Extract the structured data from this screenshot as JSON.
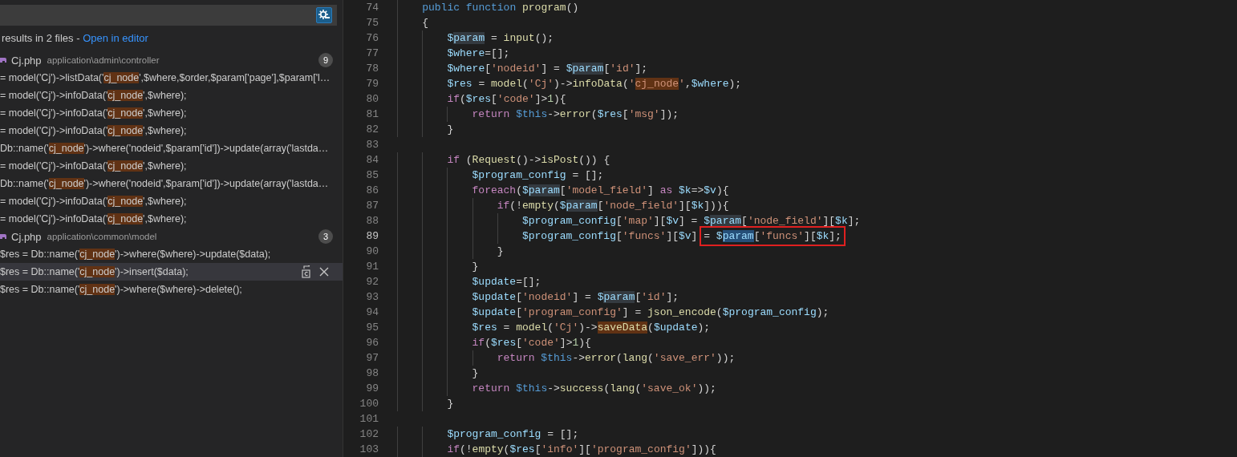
{
  "search_panel": {
    "exclude_settings_toggle": {
      "on": true
    },
    "summary": {
      "text": "results in 2 files - ",
      "link": "Open in editor"
    },
    "files": [
      {
        "name": "Cj.php",
        "path": "application\\admin\\controller",
        "count": "9",
        "matches": [
          {
            "before": "= model('Cj')->listData('",
            "match": "cj_node",
            "after": "',$where,$order,$param['page'],$param['l…",
            "selected": false
          },
          {
            "before": "= model('Cj')->infoData('",
            "match": "cj_node",
            "after": "',$where);",
            "selected": false
          },
          {
            "before": "= model('Cj')->infoData('",
            "match": "cj_node",
            "after": "',$where);",
            "selected": false
          },
          {
            "before": "= model('Cj')->infoData('",
            "match": "cj_node",
            "after": "',$where);",
            "selected": false
          },
          {
            "before": "Db::name('",
            "match": "cj_node",
            "after": "')->where('nodeid',$param['id'])->update(array('lastda…",
            "selected": false
          },
          {
            "before": "= model('Cj')->infoData('",
            "match": "cj_node",
            "after": "',$where);",
            "selected": false
          },
          {
            "before": "Db::name('",
            "match": "cj_node",
            "after": "')->where('nodeid',$param['id'])->update(array('lastda…",
            "selected": false
          },
          {
            "before": "= model('Cj')->infoData('",
            "match": "cj_node",
            "after": "',$where);",
            "selected": false
          },
          {
            "before": "= model('Cj')->infoData('",
            "match": "cj_node",
            "after": "',$where);",
            "selected": false
          }
        ]
      },
      {
        "name": "Cj.php",
        "path": "application\\common\\model",
        "count": "3",
        "matches": [
          {
            "before": "$res = Db::name('",
            "match": "cj_node",
            "after": "')->where($where)->update($data);",
            "selected": false
          },
          {
            "before": "$res = Db::name('",
            "match": "cj_node",
            "after": "')->insert($data);",
            "selected": true
          },
          {
            "before": "$res = Db::name('",
            "match": "cj_node",
            "after": "')->where($where)->delete();",
            "selected": false
          }
        ]
      }
    ]
  },
  "editor": {
    "lines": [
      {
        "number": "74",
        "current": false,
        "tokens": [
          {
            "text": "    public",
            "kind": "keyword"
          },
          {
            "text": " function",
            "kind": "keyword"
          },
          {
            "text": " program",
            "kind": "function"
          },
          {
            "text": "()",
            "kind": "plain"
          }
        ]
      },
      {
        "number": "75",
        "current": false,
        "tokens": [
          {
            "text": "    {",
            "kind": "plain"
          }
        ]
      },
      {
        "number": "76",
        "current": false,
        "tokens": [
          {
            "text": "        $",
            "kind": "variable"
          },
          {
            "text": "param",
            "kind": "variable",
            "same_word": true
          },
          {
            "text": " = ",
            "kind": "plain"
          },
          {
            "text": "input",
            "kind": "function"
          },
          {
            "text": "();",
            "kind": "plain"
          }
        ]
      },
      {
        "number": "77",
        "current": false,
        "tokens": [
          {
            "text": "        $where",
            "kind": "variable"
          },
          {
            "text": "=[];",
            "kind": "plain"
          }
        ]
      },
      {
        "number": "78",
        "current": false,
        "tokens": [
          {
            "text": "        $where",
            "kind": "variable"
          },
          {
            "text": "[",
            "kind": "plain"
          },
          {
            "text": "'nodeid'",
            "kind": "string"
          },
          {
            "text": "] = ",
            "kind": "plain"
          },
          {
            "text": "$",
            "kind": "variable"
          },
          {
            "text": "param",
            "kind": "variable",
            "same_word": true
          },
          {
            "text": "[",
            "kind": "plain"
          },
          {
            "text": "'id'",
            "kind": "string"
          },
          {
            "text": "];",
            "kind": "plain"
          }
        ]
      },
      {
        "number": "79",
        "current": false,
        "tokens": [
          {
            "text": "        $res",
            "kind": "variable"
          },
          {
            "text": " = ",
            "kind": "plain"
          },
          {
            "text": "model",
            "kind": "function"
          },
          {
            "text": "(",
            "kind": "plain"
          },
          {
            "text": "'Cj'",
            "kind": "string"
          },
          {
            "text": ")->",
            "kind": "plain"
          },
          {
            "text": "infoData",
            "kind": "function"
          },
          {
            "text": "(",
            "kind": "plain"
          },
          {
            "text": "'",
            "kind": "string"
          },
          {
            "text": "cj_node",
            "kind": "string",
            "search_hit": true
          },
          {
            "text": "'",
            "kind": "string"
          },
          {
            "text": ",",
            "kind": "plain"
          },
          {
            "text": "$where",
            "kind": "variable"
          },
          {
            "text": ");",
            "kind": "plain"
          }
        ]
      },
      {
        "number": "80",
        "current": false,
        "tokens": [
          {
            "text": "        if",
            "kind": "control"
          },
          {
            "text": "(",
            "kind": "plain"
          },
          {
            "text": "$res",
            "kind": "variable"
          },
          {
            "text": "[",
            "kind": "plain"
          },
          {
            "text": "'code'",
            "kind": "string"
          },
          {
            "text": "]>",
            "kind": "plain"
          },
          {
            "text": "1",
            "kind": "number"
          },
          {
            "text": "){",
            "kind": "plain"
          }
        ]
      },
      {
        "number": "81",
        "current": false,
        "tokens": [
          {
            "text": "            return",
            "kind": "control"
          },
          {
            "text": " $this",
            "kind": "keyword"
          },
          {
            "text": "->",
            "kind": "plain"
          },
          {
            "text": "error",
            "kind": "function"
          },
          {
            "text": "(",
            "kind": "plain"
          },
          {
            "text": "$res",
            "kind": "variable"
          },
          {
            "text": "[",
            "kind": "plain"
          },
          {
            "text": "'msg'",
            "kind": "string"
          },
          {
            "text": "]);",
            "kind": "plain"
          }
        ]
      },
      {
        "number": "82",
        "current": false,
        "tokens": [
          {
            "text": "        }",
            "kind": "plain"
          }
        ]
      },
      {
        "number": "83",
        "current": false
      },
      {
        "number": "84",
        "current": false,
        "tokens": [
          {
            "text": "        if",
            "kind": "control"
          },
          {
            "text": " (",
            "kind": "plain"
          },
          {
            "text": "Request",
            "kind": "function"
          },
          {
            "text": "()->",
            "kind": "plain"
          },
          {
            "text": "isPost",
            "kind": "function"
          },
          {
            "text": "()) {",
            "kind": "plain"
          }
        ]
      },
      {
        "number": "85",
        "current": false,
        "tokens": [
          {
            "text": "            $program_config",
            "kind": "variable"
          },
          {
            "text": " = [];",
            "kind": "plain"
          }
        ]
      },
      {
        "number": "86",
        "current": false,
        "tokens": [
          {
            "text": "            foreach",
            "kind": "control"
          },
          {
            "text": "(",
            "kind": "plain"
          },
          {
            "text": "$",
            "kind": "variable"
          },
          {
            "text": "param",
            "kind": "variable",
            "same_word": true
          },
          {
            "text": "[",
            "kind": "plain"
          },
          {
            "text": "'model_field'",
            "kind": "string"
          },
          {
            "text": "] ",
            "kind": "plain"
          },
          {
            "text": "as",
            "kind": "control"
          },
          {
            "text": " $k",
            "kind": "variable"
          },
          {
            "text": "=>",
            "kind": "plain"
          },
          {
            "text": "$v",
            "kind": "variable"
          },
          {
            "text": "){",
            "kind": "plain"
          }
        ]
      },
      {
        "number": "87",
        "current": false,
        "tokens": [
          {
            "text": "                if",
            "kind": "control"
          },
          {
            "text": "(!",
            "kind": "plain"
          },
          {
            "text": "empty",
            "kind": "function"
          },
          {
            "text": "(",
            "kind": "plain"
          },
          {
            "text": "$",
            "kind": "variable"
          },
          {
            "text": "param",
            "kind": "variable",
            "same_word": true
          },
          {
            "text": "[",
            "kind": "plain"
          },
          {
            "text": "'node_field'",
            "kind": "string"
          },
          {
            "text": "][",
            "kind": "plain"
          },
          {
            "text": "$k",
            "kind": "variable"
          },
          {
            "text": "])){",
            "kind": "plain"
          }
        ]
      },
      {
        "number": "88",
        "current": false,
        "tokens": [
          {
            "text": "                    $program_config",
            "kind": "variable"
          },
          {
            "text": "[",
            "kind": "plain"
          },
          {
            "text": "'map'",
            "kind": "string"
          },
          {
            "text": "][",
            "kind": "plain"
          },
          {
            "text": "$v",
            "kind": "variable"
          },
          {
            "text": "] = ",
            "kind": "plain"
          },
          {
            "text": "$",
            "kind": "variable"
          },
          {
            "text": "param",
            "kind": "variable",
            "same_word": true
          },
          {
            "text": "[",
            "kind": "plain"
          },
          {
            "text": "'node_field'",
            "kind": "string"
          },
          {
            "text": "][",
            "kind": "plain"
          },
          {
            "text": "$k",
            "kind": "variable"
          },
          {
            "text": "];",
            "kind": "plain"
          }
        ]
      },
      {
        "number": "89",
        "current": true,
        "tokens": [
          {
            "text": "                    $program_config",
            "kind": "variable"
          },
          {
            "text": "[",
            "kind": "plain"
          },
          {
            "text": "'funcs'",
            "kind": "string"
          },
          {
            "text": "][",
            "kind": "plain"
          },
          {
            "text": "$v",
            "kind": "variable"
          },
          {
            "text": "] ",
            "kind": "plain"
          },
          {
            "text": "= ",
            "kind": "plain",
            "boxed": true
          },
          {
            "text": "$",
            "kind": "variable",
            "boxed": true
          },
          {
            "text": "param",
            "kind": "variable",
            "selected": true,
            "boxed": true
          },
          {
            "text": "[",
            "kind": "plain",
            "boxed": true
          },
          {
            "text": "'funcs'",
            "kind": "string",
            "boxed": true
          },
          {
            "text": "][",
            "kind": "plain",
            "boxed": true
          },
          {
            "text": "$k",
            "kind": "variable",
            "boxed": true
          },
          {
            "text": "];",
            "kind": "plain",
            "boxed": true
          }
        ]
      },
      {
        "number": "90",
        "current": false,
        "tokens": [
          {
            "text": "                }",
            "kind": "plain"
          }
        ]
      },
      {
        "number": "91",
        "current": false,
        "tokens": [
          {
            "text": "            }",
            "kind": "plain"
          }
        ]
      },
      {
        "number": "92",
        "current": false,
        "tokens": [
          {
            "text": "            $update",
            "kind": "variable"
          },
          {
            "text": "=[];",
            "kind": "plain"
          }
        ]
      },
      {
        "number": "93",
        "current": false,
        "tokens": [
          {
            "text": "            $update",
            "kind": "variable"
          },
          {
            "text": "[",
            "kind": "plain"
          },
          {
            "text": "'nodeid'",
            "kind": "string"
          },
          {
            "text": "] = ",
            "kind": "plain"
          },
          {
            "text": "$",
            "kind": "variable"
          },
          {
            "text": "param",
            "kind": "variable",
            "same_word": true
          },
          {
            "text": "[",
            "kind": "plain"
          },
          {
            "text": "'id'",
            "kind": "string"
          },
          {
            "text": "];",
            "kind": "plain"
          }
        ]
      },
      {
        "number": "94",
        "current": false,
        "tokens": [
          {
            "text": "            $update",
            "kind": "variable"
          },
          {
            "text": "[",
            "kind": "plain"
          },
          {
            "text": "'program_config'",
            "kind": "string"
          },
          {
            "text": "] = ",
            "kind": "plain"
          },
          {
            "text": "json_encode",
            "kind": "function"
          },
          {
            "text": "(",
            "kind": "plain"
          },
          {
            "text": "$program_config",
            "kind": "variable"
          },
          {
            "text": ");",
            "kind": "plain"
          }
        ]
      },
      {
        "number": "95",
        "current": false,
        "tokens": [
          {
            "text": "            $res",
            "kind": "variable"
          },
          {
            "text": " = ",
            "kind": "plain"
          },
          {
            "text": "model",
            "kind": "function"
          },
          {
            "text": "(",
            "kind": "plain"
          },
          {
            "text": "'Cj'",
            "kind": "string"
          },
          {
            "text": ")->",
            "kind": "plain"
          },
          {
            "text": "saveData",
            "kind": "function",
            "search_hit": true
          },
          {
            "text": "(",
            "kind": "plain"
          },
          {
            "text": "$update",
            "kind": "variable"
          },
          {
            "text": ");",
            "kind": "plain"
          }
        ]
      },
      {
        "number": "96",
        "current": false,
        "tokens": [
          {
            "text": "            if",
            "kind": "control"
          },
          {
            "text": "(",
            "kind": "plain"
          },
          {
            "text": "$res",
            "kind": "variable"
          },
          {
            "text": "[",
            "kind": "plain"
          },
          {
            "text": "'code'",
            "kind": "string"
          },
          {
            "text": "]>",
            "kind": "plain"
          },
          {
            "text": "1",
            "kind": "number"
          },
          {
            "text": "){",
            "kind": "plain"
          }
        ]
      },
      {
        "number": "97",
        "current": false,
        "tokens": [
          {
            "text": "                return",
            "kind": "control"
          },
          {
            "text": " $this",
            "kind": "keyword"
          },
          {
            "text": "->",
            "kind": "plain"
          },
          {
            "text": "error",
            "kind": "function"
          },
          {
            "text": "(",
            "kind": "plain"
          },
          {
            "text": "lang",
            "kind": "function"
          },
          {
            "text": "(",
            "kind": "plain"
          },
          {
            "text": "'save_err'",
            "kind": "string"
          },
          {
            "text": "));",
            "kind": "plain"
          }
        ]
      },
      {
        "number": "98",
        "current": false,
        "tokens": [
          {
            "text": "            }",
            "kind": "plain"
          }
        ]
      },
      {
        "number": "99",
        "current": false,
        "tokens": [
          {
            "text": "            return",
            "kind": "control"
          },
          {
            "text": " $this",
            "kind": "keyword"
          },
          {
            "text": "->",
            "kind": "plain"
          },
          {
            "text": "success",
            "kind": "function"
          },
          {
            "text": "(",
            "kind": "plain"
          },
          {
            "text": "lang",
            "kind": "function"
          },
          {
            "text": "(",
            "kind": "plain"
          },
          {
            "text": "'save_ok'",
            "kind": "string"
          },
          {
            "text": "));",
            "kind": "plain"
          }
        ]
      },
      {
        "number": "100",
        "current": false,
        "tokens": [
          {
            "text": "        }",
            "kind": "plain"
          }
        ]
      },
      {
        "number": "101",
        "current": false
      },
      {
        "number": "102",
        "current": false,
        "tokens": [
          {
            "text": "        $program_config",
            "kind": "variable"
          },
          {
            "text": " = [];",
            "kind": "plain"
          }
        ]
      },
      {
        "number": "103",
        "current": false,
        "tokens": [
          {
            "text": "        if",
            "kind": "control"
          },
          {
            "text": "(!",
            "kind": "plain"
          },
          {
            "text": "empty",
            "kind": "function"
          },
          {
            "text": "(",
            "kind": "plain"
          },
          {
            "text": "$res",
            "kind": "variable"
          },
          {
            "text": "[",
            "kind": "plain"
          },
          {
            "text": "'info'",
            "kind": "string"
          },
          {
            "text": "][",
            "kind": "plain"
          },
          {
            "text": "'program_config'",
            "kind": "string"
          },
          {
            "text": "])){",
            "kind": "plain"
          }
        ]
      }
    ]
  }
}
